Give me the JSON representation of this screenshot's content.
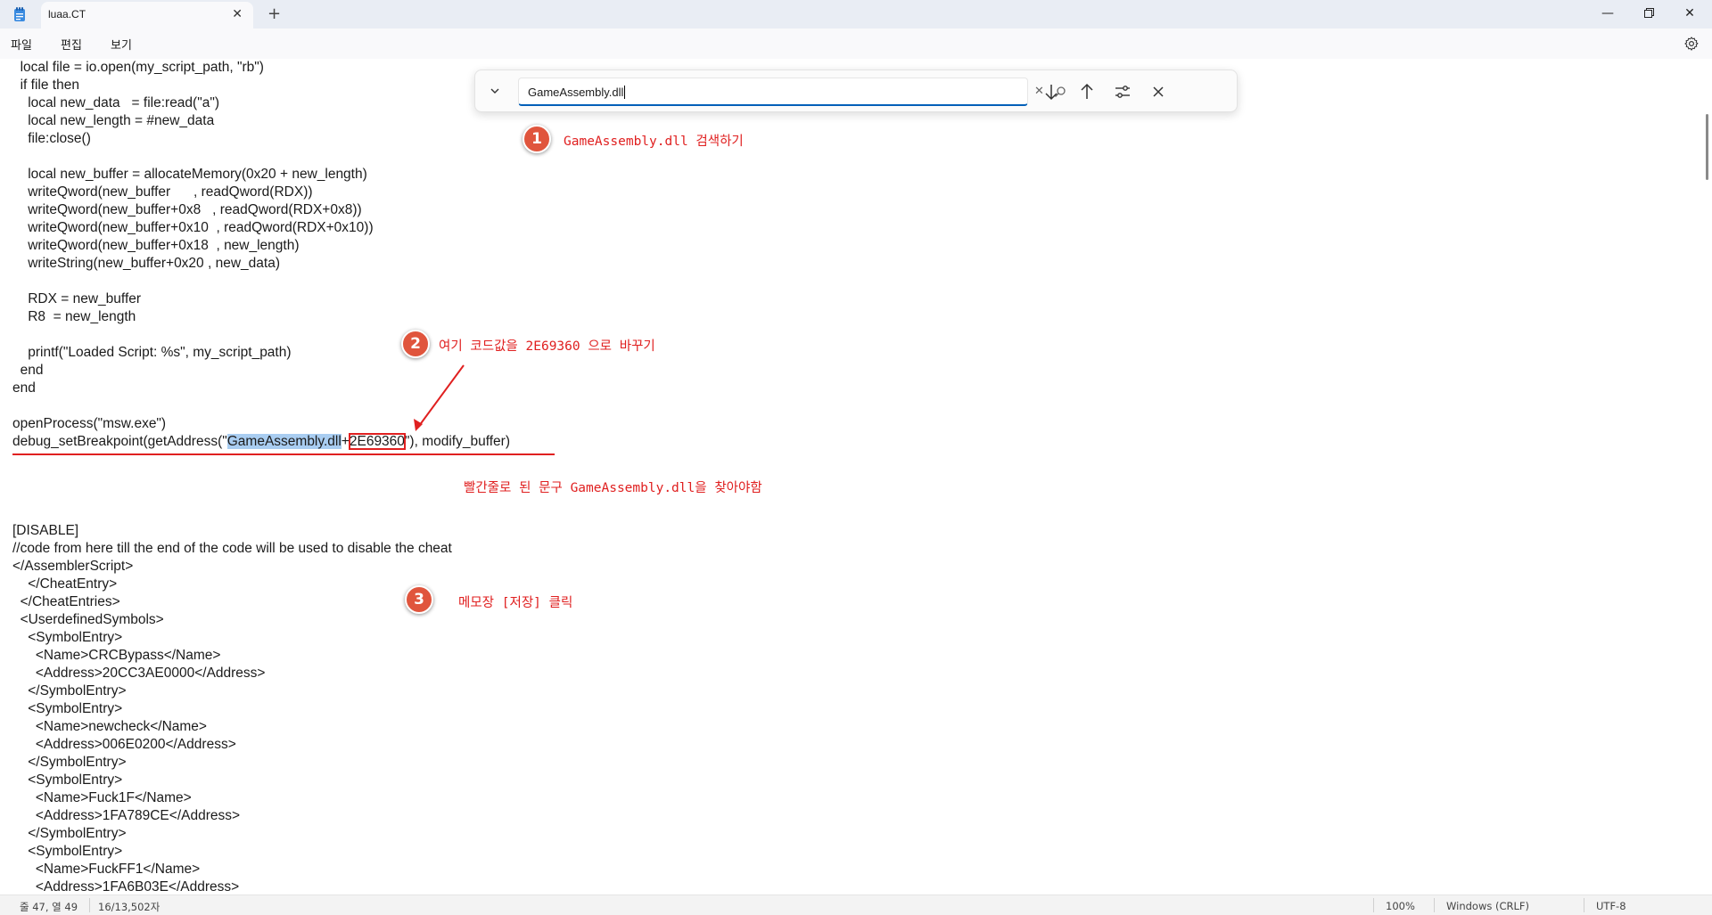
{
  "tab": {
    "title": "luaa.CT"
  },
  "menu": [
    "파일",
    "편집",
    "보기"
  ],
  "find": {
    "value": "GameAssembly.dll"
  },
  "code": {
    "before": [
      "  local file = io.open(my_script_path, \"rb\")",
      "  if file then",
      "    local new_data   = file:read(\"a\")",
      "    local new_length = #new_data",
      "    file:close()",
      "",
      "    local new_buffer = allocateMemory(0x20 + new_length)",
      "    writeQword(new_buffer      , readQword(RDX))",
      "    writeQword(new_buffer+0x8   , readQword(RDX+0x8))",
      "    writeQword(new_buffer+0x10  , readQword(RDX+0x10))",
      "    writeQword(new_buffer+0x18  , new_length)",
      "    writeString(new_buffer+0x20 , new_data)",
      "",
      "    RDX = new_buffer",
      "    R8  = new_length",
      "",
      "    printf(\"Loaded Script: %s\", my_script_path)",
      "  end",
      "end",
      "",
      "openProcess(\"msw.exe\")"
    ],
    "bp_prefix": "debug_setBreakpoint(getAddress(\"",
    "bp_highlight": "GameAssembly.dll",
    "bp_plus": "+",
    "bp_boxed": "2E69360",
    "bp_suffix": "\"), modify_buffer)",
    "after": [
      "",
      "",
      "",
      "",
      "[DISABLE]",
      "//code from here till the end of the code will be used to disable the cheat",
      "</AssemblerScript>",
      "    </CheatEntry>",
      "  </CheatEntries>",
      "  <UserdefinedSymbols>",
      "    <SymbolEntry>",
      "      <Name>CRCBypass</Name>",
      "      <Address>20CC3AE0000</Address>",
      "    </SymbolEntry>",
      "    <SymbolEntry>",
      "      <Name>newcheck</Name>",
      "      <Address>006E0200</Address>",
      "    </SymbolEntry>",
      "    <SymbolEntry>",
      "      <Name>Fuck1F</Name>",
      "      <Address>1FA789CE</Address>",
      "    </SymbolEntry>",
      "    <SymbolEntry>",
      "      <Name>FuckFF1</Name>",
      "      <Address>1FA6B03E</Address>"
    ]
  },
  "annotations": [
    {
      "num": "1",
      "text": "GameAssembly.dll 검색하기"
    },
    {
      "num": "2",
      "text": "여기 코드값을 2E69360 으로 바꾸기"
    },
    {
      "num": "3",
      "text": "메모장 [저장] 클릭"
    },
    {
      "text": "빨간줄로 된 문구 GameAssembly.dll을 찾아야함"
    }
  ],
  "status": {
    "position": "줄 47, 열 49",
    "chars": "16/13,502자",
    "zoom": "100%",
    "line_ending": "Windows (CRLF)",
    "encoding": "UTF-8"
  },
  "colors": {
    "annotation": "#e02020",
    "badge": "#e0553d",
    "highlight": "#a9cdf1",
    "accent": "#005fb8"
  }
}
